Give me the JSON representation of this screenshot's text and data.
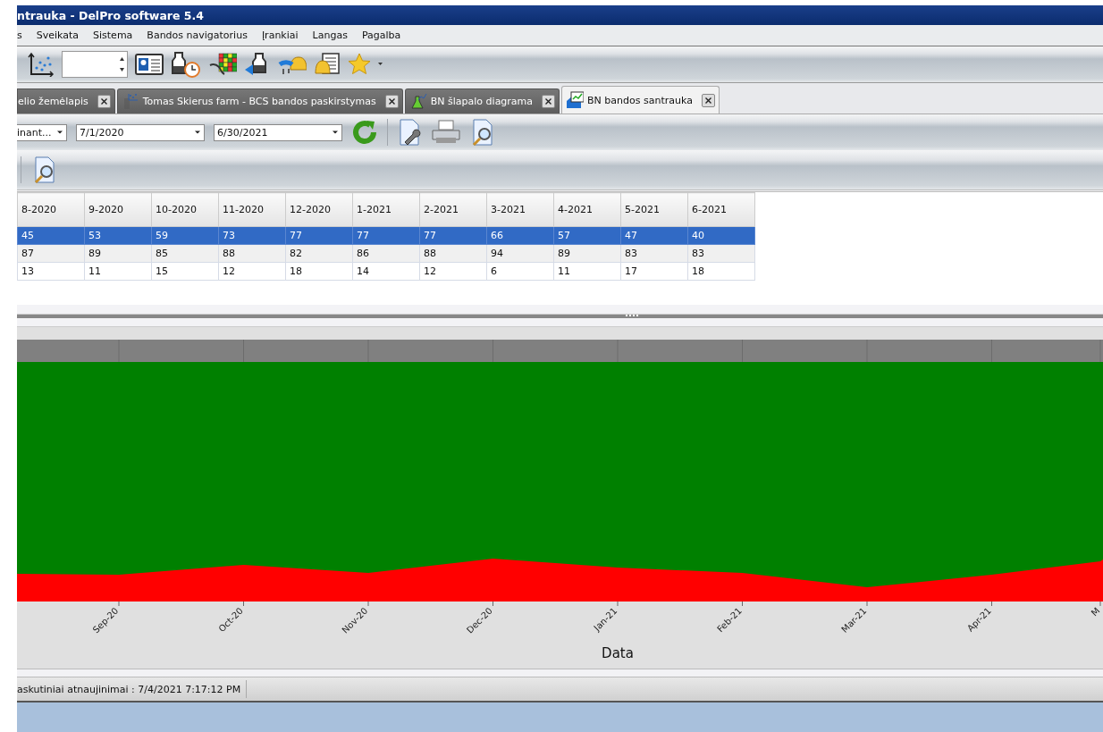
{
  "window": {
    "title": "ntrauka - DelPro software 5.4"
  },
  "menu": [
    "s",
    "Sveikata",
    "Sistema",
    "Bandos navigatorius",
    "Įrankiai",
    "Langas",
    "Pagalba"
  ],
  "tabs": [
    {
      "label": "elio žemėlapis",
      "selected": false
    },
    {
      "label": "Tomas Skierus farm - BCS bandos paskirstymas",
      "selected": false
    },
    {
      "label": "BN šlapalo diagrama",
      "selected": false
    },
    {
      "label": "BN bandos santrauka",
      "selected": true
    }
  ],
  "filters": {
    "type_dropdown": "inant...",
    "date_from": "7/1/2020",
    "date_to": "6/30/2021"
  },
  "table": {
    "columns": [
      "8-2020",
      "9-2020",
      "10-2020",
      "11-2020",
      "12-2020",
      "1-2021",
      "2-2021",
      "3-2021",
      "4-2021",
      "5-2021",
      "6-2021"
    ],
    "rows": [
      {
        "selected": true,
        "cells": [
          "45",
          "53",
          "59",
          "73",
          "77",
          "77",
          "77",
          "66",
          "57",
          "47",
          "40"
        ]
      },
      {
        "selected": false,
        "cells": [
          "87",
          "89",
          "85",
          "88",
          "82",
          "86",
          "88",
          "94",
          "89",
          "83",
          "83"
        ]
      },
      {
        "selected": false,
        "cells": [
          "13",
          "11",
          "15",
          "12",
          "18",
          "14",
          "12",
          "6",
          "11",
          "17",
          "18"
        ]
      }
    ]
  },
  "chart": {
    "xlabel": "Data",
    "x_labels": [
      "Sep-20",
      "Oct-20",
      "Nov-20",
      "Dec-20",
      "Jan-21",
      "Feb-21",
      "Mar-21",
      "Apr-21",
      "M"
    ]
  },
  "status_bar": {
    "text": "askutiniai atnaujinimai : 7/4/2021 7:17:12 PM"
  }
}
